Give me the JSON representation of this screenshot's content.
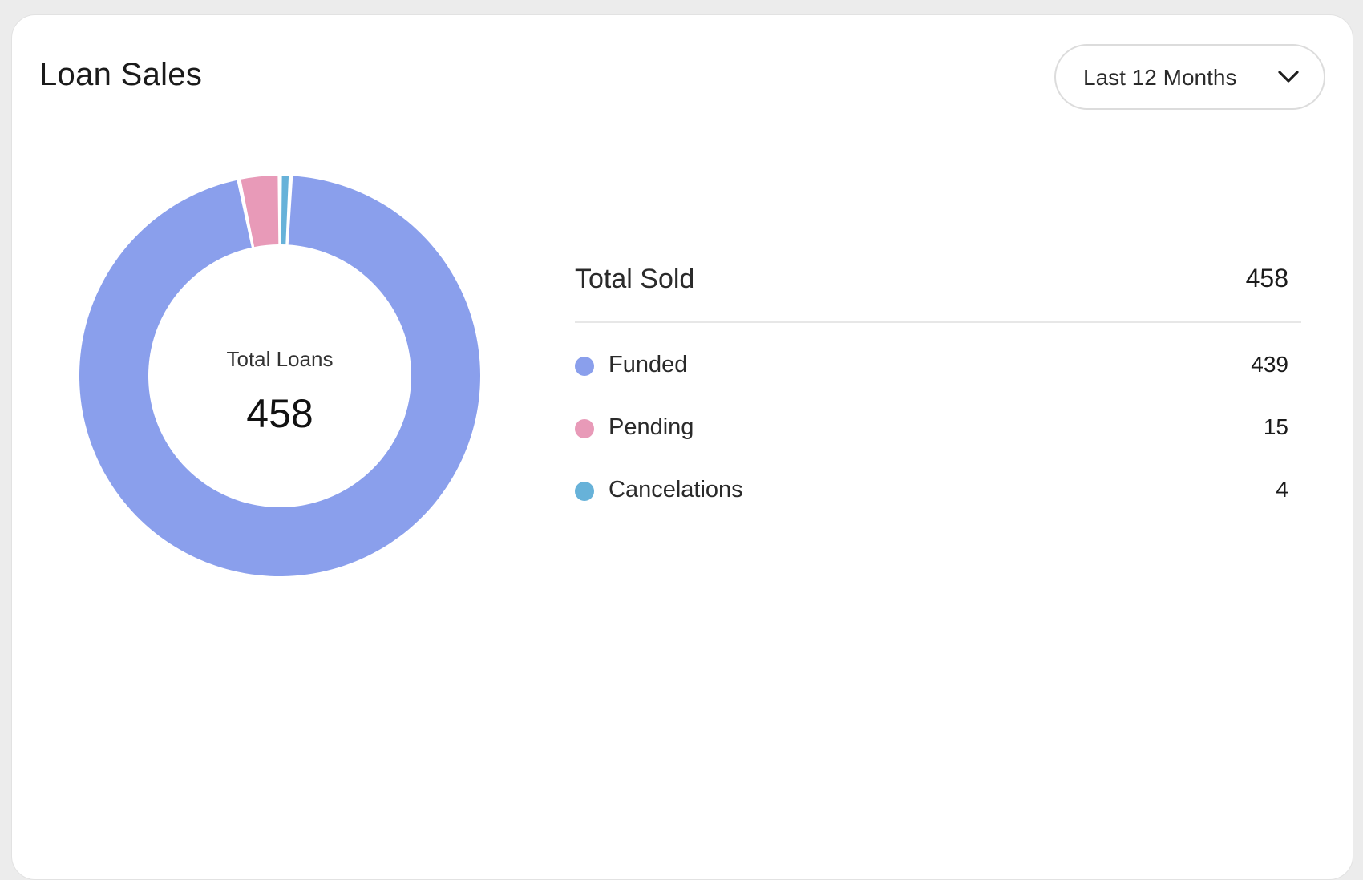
{
  "card": {
    "title": "Loan Sales"
  },
  "filter": {
    "selected": "Last 12 Months",
    "icon": "chevron-down-icon"
  },
  "summary": {
    "total_label": "Total Sold",
    "total_value": "458",
    "items": [
      {
        "label": "Funded",
        "value": "439",
        "color": "#8a9fec"
      },
      {
        "label": "Pending",
        "value": "15",
        "color": "#e89ab8"
      },
      {
        "label": "Cancelations",
        "value": "4",
        "color": "#67b2d9"
      }
    ]
  },
  "chart_data": {
    "type": "pie",
    "center_label": "Total Loans",
    "center_value": "458",
    "categories": [
      "Cancelations",
      "Funded",
      "Pending"
    ],
    "values": [
      4,
      439,
      15
    ],
    "colors": [
      "#67b2d9",
      "#8a9fec",
      "#e89ab8"
    ]
  }
}
